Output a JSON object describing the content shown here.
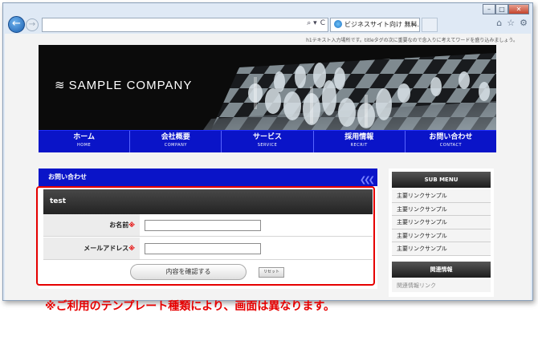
{
  "browser": {
    "tab_title": "ビジネスサイト向け 無料...",
    "tab_close": "×",
    "window_buttons": [
      "–",
      "□",
      "✕"
    ],
    "nav_back": "←",
    "nav_forward": "→",
    "address_tools": [
      "⌕ ▾",
      "C"
    ],
    "toolbar_icons": [
      "home-icon",
      "star-icon",
      "gear-icon"
    ]
  },
  "page": {
    "header_text": "h1テキスト入力場所です。titleタグの次に重要なので念入りに考えてワードを盛り込みましょう。",
    "logo": "SAMPLE COMPANY",
    "menu": [
      {
        "ja": "ホーム",
        "en": "HOME"
      },
      {
        "ja": "会社概要",
        "en": "COMPANY"
      },
      {
        "ja": "サービス",
        "en": "SERVICE"
      },
      {
        "ja": "採用情報",
        "en": "RECRIT"
      },
      {
        "ja": "お問い合わせ",
        "en": "CONTACT"
      }
    ],
    "main_heading": "お問い合わせ",
    "form_title": "test",
    "fields": [
      {
        "label": "お名前",
        "required_mark": "※",
        "value": ""
      },
      {
        "label": "メールアドレス",
        "required_mark": "※",
        "value": ""
      }
    ],
    "submit_label": "内容を確認する",
    "reset_label": "リセット",
    "sub_menu_title": "SUB MENU",
    "sub_menu_items": [
      "主要リンクサンプル",
      "主要リンクサンプル",
      "主要リンクサンプル",
      "主要リンクサンプル",
      "主要リンクサンプル"
    ],
    "related_title": "関連情報",
    "related_item": "関連情報リンク"
  },
  "note": "※ご利用のテンプレート種類により、画面は異なります。",
  "colors": {
    "menu_blue": "#0a14c8",
    "highlight_red": "#e60000"
  }
}
